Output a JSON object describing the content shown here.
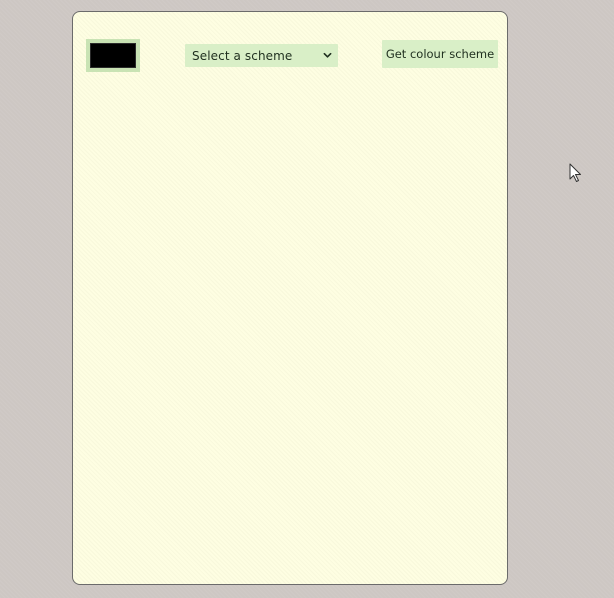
{
  "colors": {
    "page_background": "#cdc7c3",
    "card_background": "#fefee2",
    "control_background": "#d9efc7",
    "swatch_value": "#000000"
  },
  "controls": {
    "color_picker": {
      "value": "#000000"
    },
    "scheme_select": {
      "selected_label": "Select a scheme",
      "icon": "chevron-down-icon"
    },
    "get_button": {
      "label": "Get colour scheme"
    }
  },
  "cursor": {
    "icon": "mouse-pointer-icon"
  }
}
